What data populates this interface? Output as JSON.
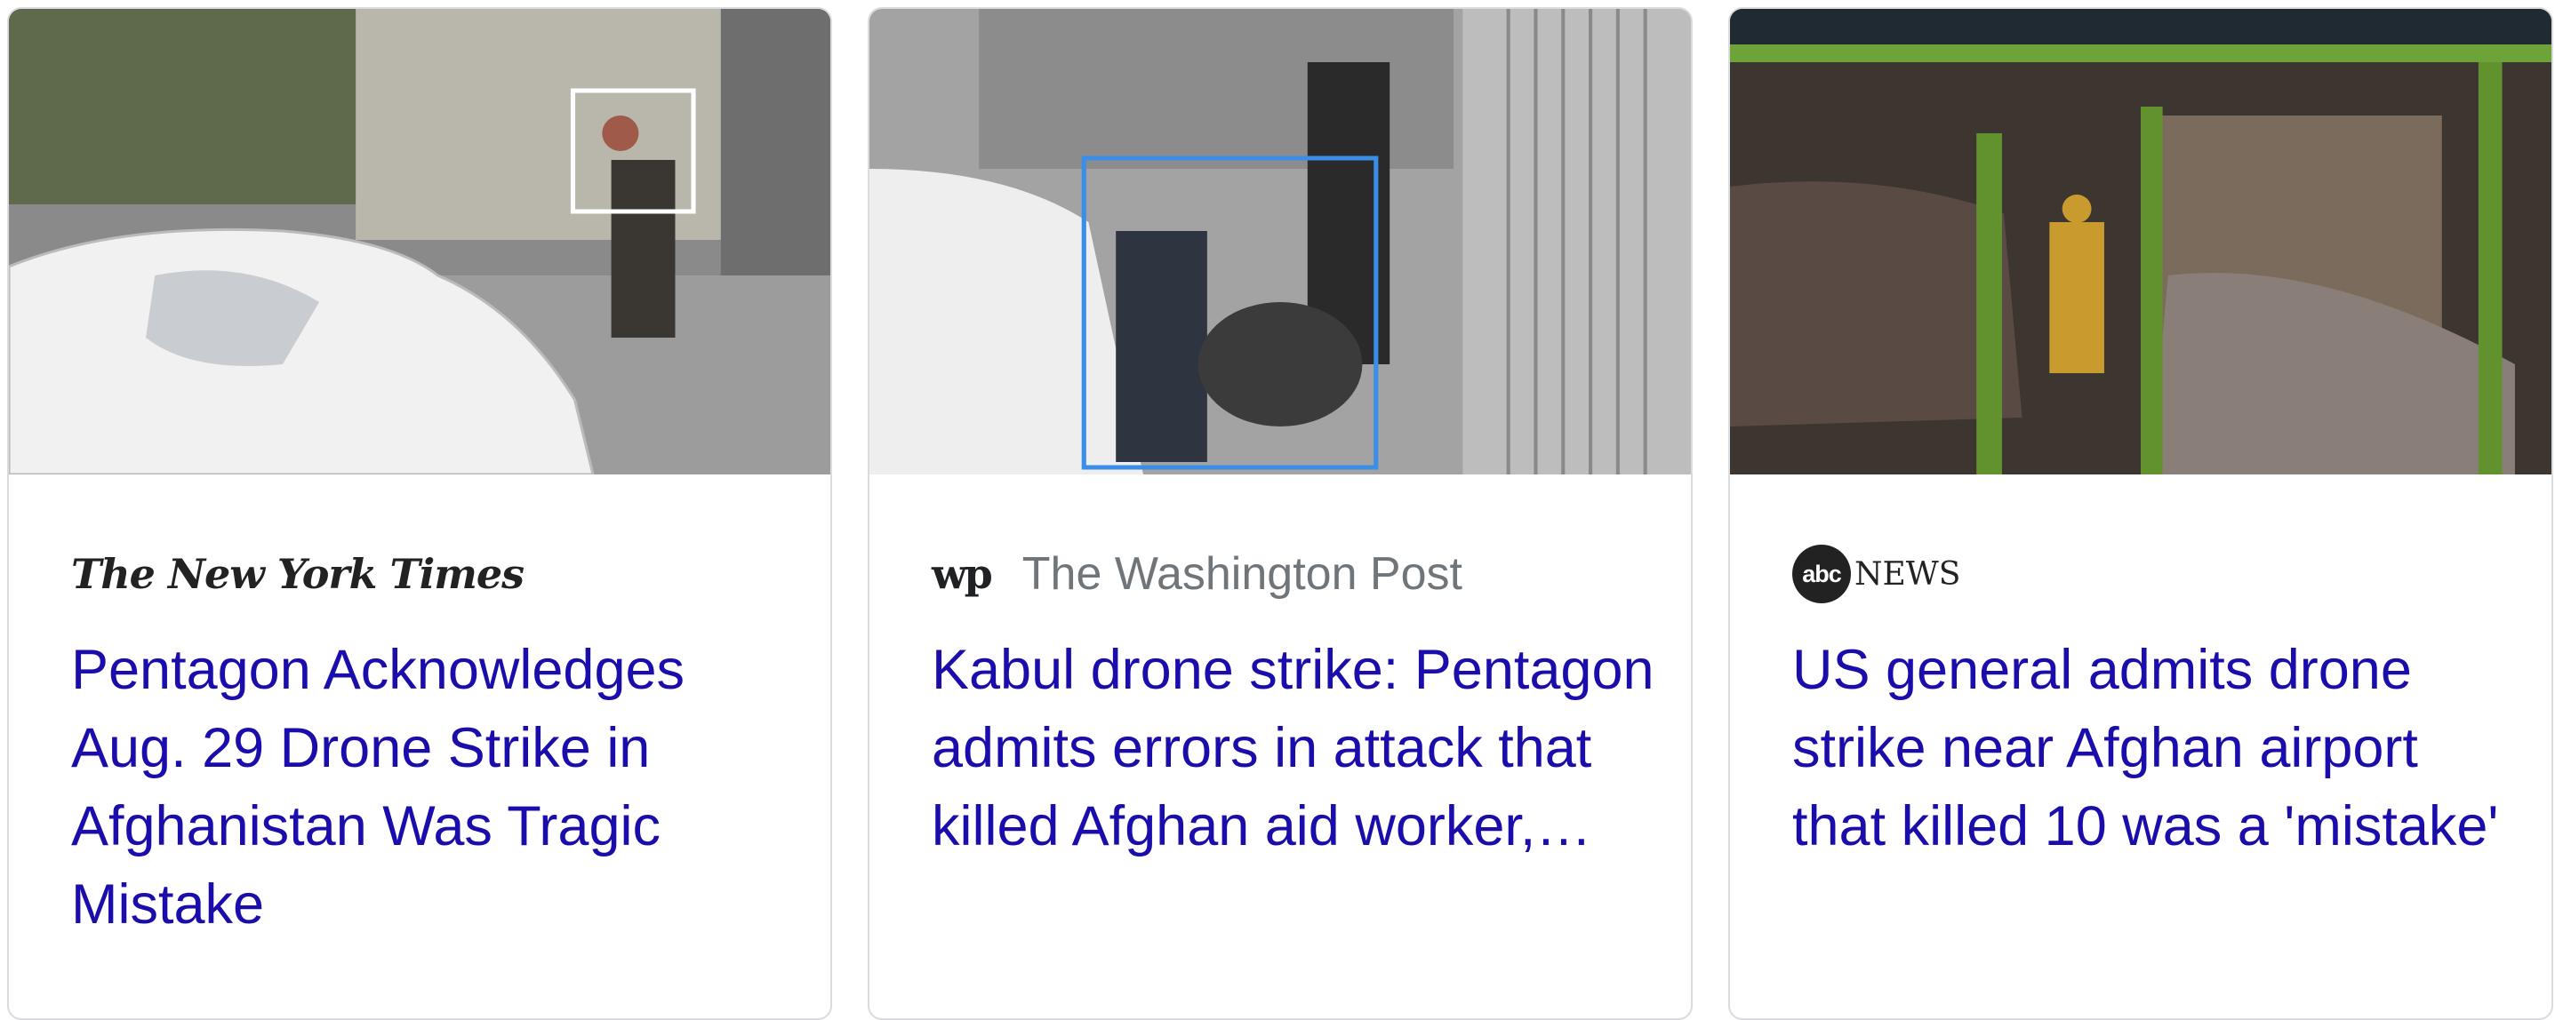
{
  "cards": [
    {
      "source": "The New York Times",
      "headline": "Pentagon Acknowledges Aug. 29 Drone Strike in Afghanistan Was Tragic Mistake"
    },
    {
      "source_mark": "wp",
      "source": "The Washington Post",
      "headline": "Kabul drone strike: Pentagon admits errors in attack that killed Afghan aid worker,…"
    },
    {
      "source_mark": "abc",
      "source": "NEWS",
      "headline": "US general admits drone strike near Afghan airport that killed 10 was a 'mistake'"
    }
  ],
  "colors": {
    "headline": "#1a0dab",
    "source_text": "#70757a",
    "card_border": "#dadce0"
  },
  "icons": [
    "nyt-logo",
    "wp-logo-icon",
    "abc-news-logo"
  ]
}
